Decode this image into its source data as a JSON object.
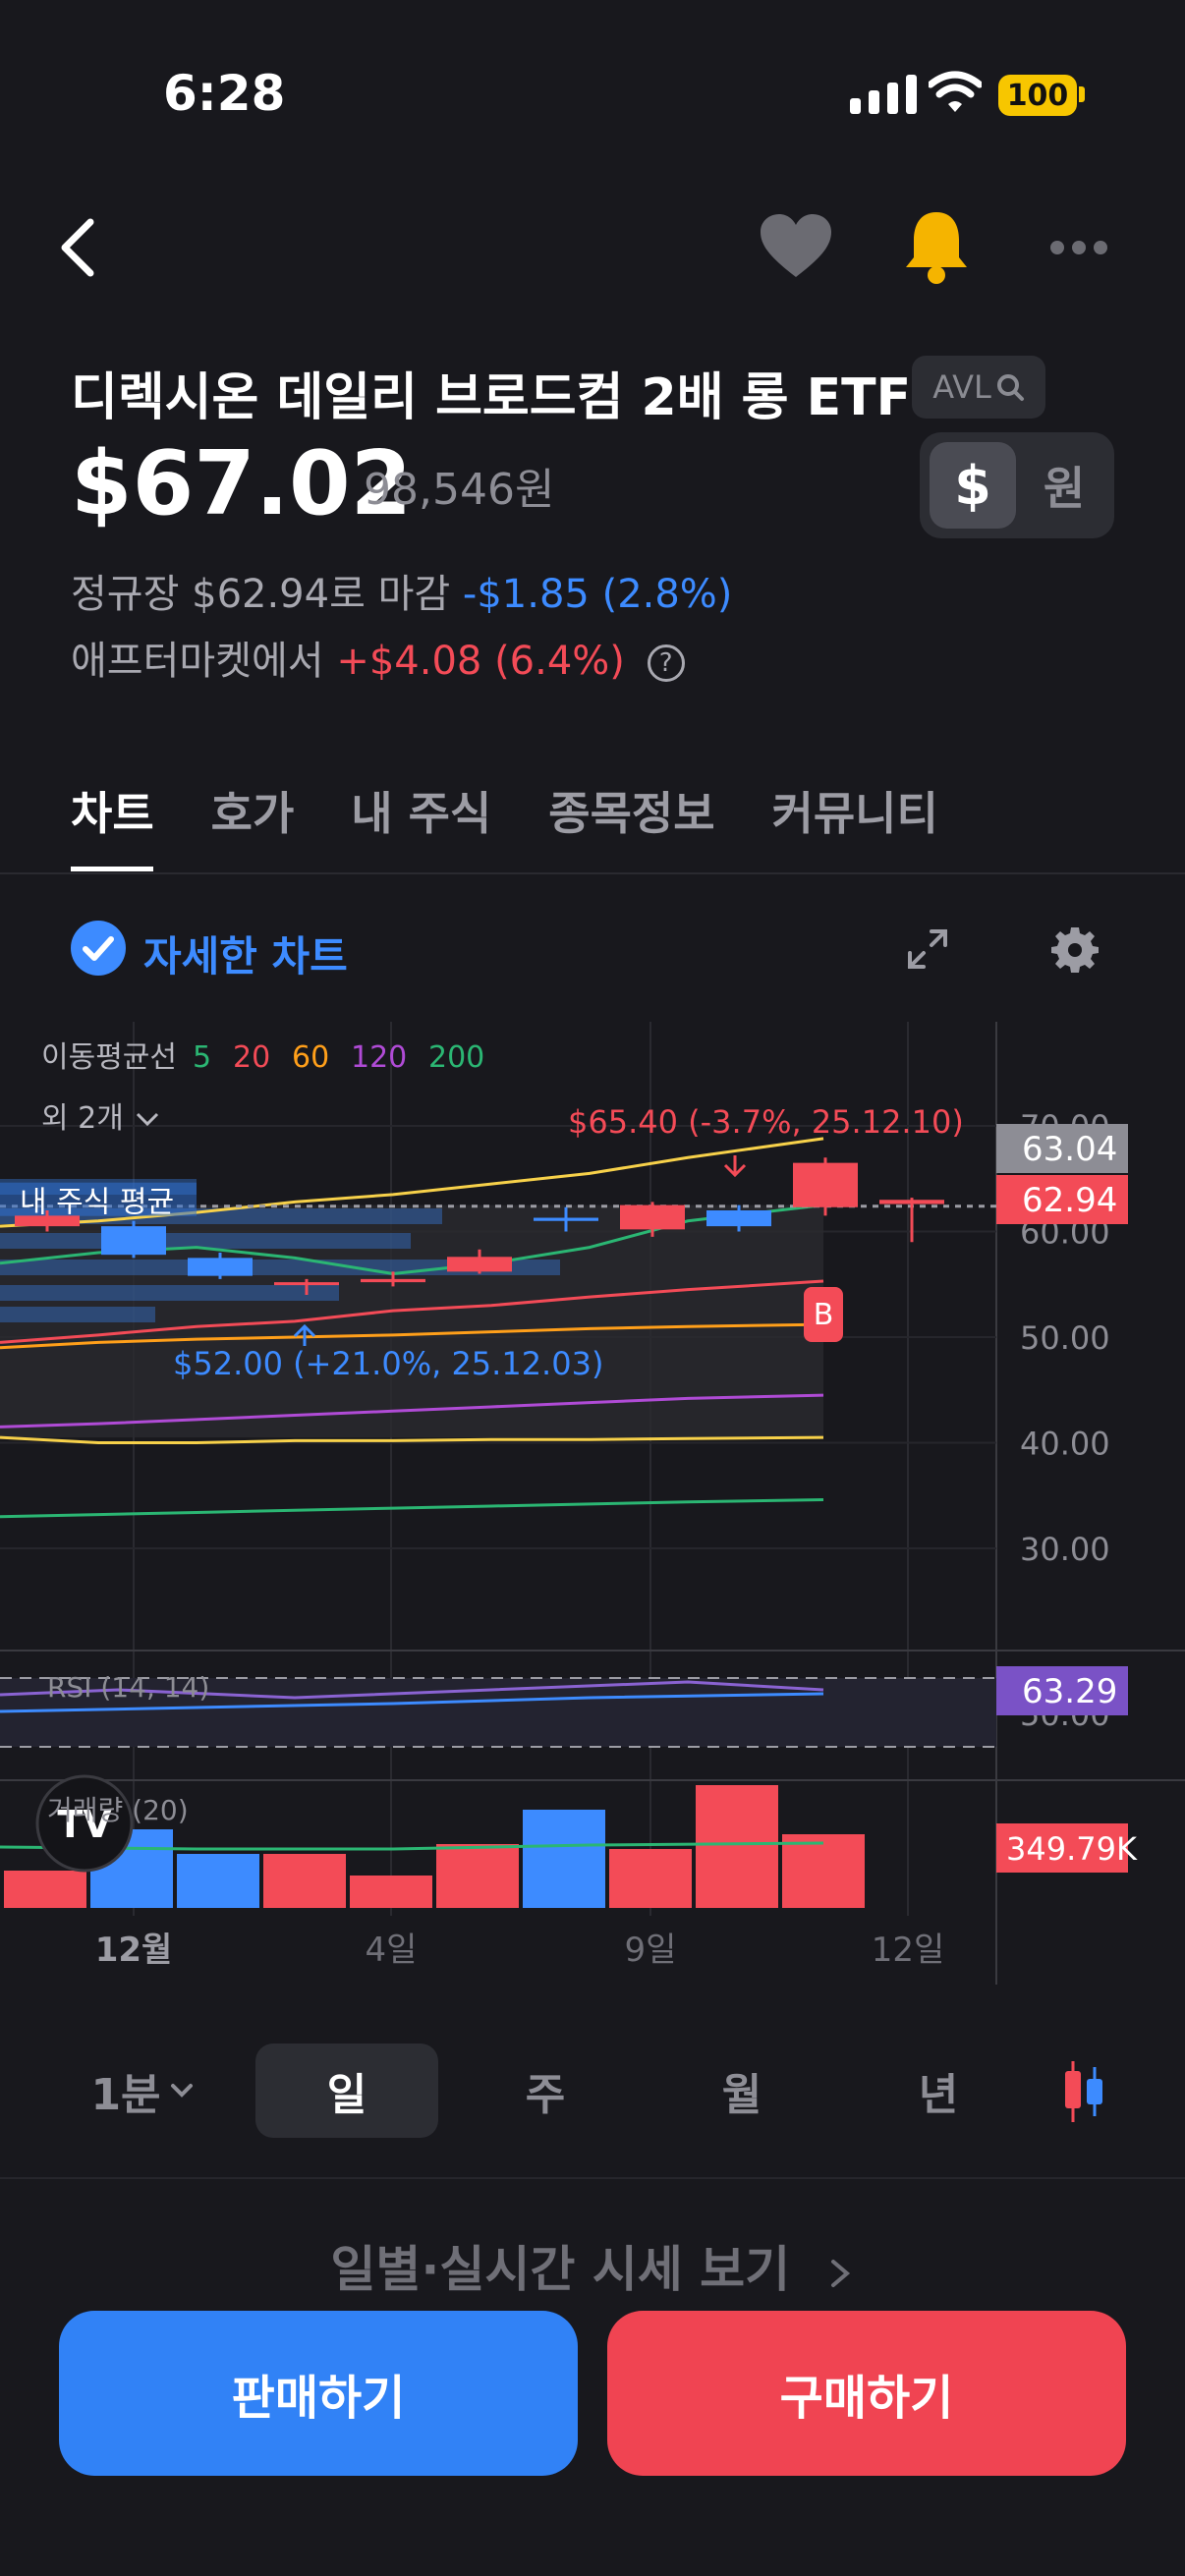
{
  "status_bar": {
    "time": "6:28",
    "battery": "100"
  },
  "header": {
    "title": "디렉시온 데일리 브로드컴 2배 롱 ETF",
    "ticker": "AVL",
    "price": "$67.02",
    "price_krw": "98,546원",
    "currency_dollar": "$",
    "currency_won": "원",
    "regular_close_label": "정규장 $62.94로 마감",
    "regular_change": "-$1.85 (2.8%)",
    "after_label": "애프터마켓에서",
    "after_change": "+$4.08 (6.4%)",
    "help_glyph": "?"
  },
  "tabs": [
    "차트",
    "호가",
    "내 주식",
    "종목정보",
    "커뮤니티"
  ],
  "detail_chart_label": "자세한 차트",
  "chart_data": {
    "type": "candlestick",
    "ma_title": "이동평균선",
    "ma_periods": [
      {
        "label": "5",
        "color": "#2bb673"
      },
      {
        "label": "20",
        "color": "#f34b57"
      },
      {
        "label": "60",
        "color": "#ff9f1a"
      },
      {
        "label": "120",
        "color": "#b04bd6"
      },
      {
        "label": "200",
        "color": "#2bb673"
      }
    ],
    "more_label": "외 2개",
    "my_avg_label": "내 주식 평균",
    "ylim": [
      20,
      75
    ],
    "y_ticks": [
      "70.00",
      "60.00",
      "50.00",
      "40.00",
      "30.00"
    ],
    "x_ticks": [
      "12월",
      "4일",
      "9일",
      "12일"
    ],
    "candles": [
      {
        "open": 61.5,
        "close": 60.5,
        "high": 62.0,
        "low": 60.0,
        "color": "red"
      },
      {
        "open": 60.5,
        "close": 57.8,
        "high": 61.0,
        "low": 57.5,
        "color": "blue"
      },
      {
        "open": 57.5,
        "close": 55.8,
        "high": 58.0,
        "low": 55.5,
        "color": "blue"
      },
      {
        "open": 55.0,
        "close": 55.2,
        "high": 55.5,
        "low": 54.0,
        "color": "red"
      },
      {
        "open": 55.2,
        "close": 55.5,
        "high": 56.2,
        "low": 54.8,
        "color": "red"
      },
      {
        "open": 56.2,
        "close": 57.6,
        "high": 58.3,
        "low": 56.0,
        "color": "red"
      },
      {
        "open": 61.0,
        "close": 61.3,
        "high": 62.3,
        "low": 60.0,
        "color": "blue"
      },
      {
        "open": 60.2,
        "close": 62.5,
        "high": 62.8,
        "low": 59.5,
        "color": "red"
      },
      {
        "open": 62.0,
        "close": 60.5,
        "high": 62.5,
        "low": 60.0,
        "color": "blue"
      },
      {
        "open": 62.3,
        "close": 66.5,
        "high": 67.0,
        "low": 61.5,
        "color": "red"
      },
      {
        "open": 63.0,
        "close": 62.6,
        "high": 63.2,
        "low": 59.0,
        "color": "red"
      }
    ],
    "high_annotation": "$65.40 (-3.7%, 25.12.10)",
    "low_annotation": "$52.00 (+21.0%, 25.12.03)",
    "current_price_tags": [
      "63.04",
      "62.94"
    ],
    "buy_marker": "B",
    "rsi": {
      "label": "RSI (14, 14)",
      "value": "63.29",
      "tick": "50.00"
    },
    "volume": {
      "label": "거래량 (20)",
      "value": "349.79K",
      "bars": [
        38,
        80,
        55,
        55,
        33,
        65,
        100,
        60,
        125,
        75
      ],
      "colors": [
        "red",
        "blue",
        "blue",
        "red",
        "red",
        "red",
        "blue",
        "red",
        "red",
        "red"
      ]
    }
  },
  "periods": {
    "minute": "1분",
    "day": "일",
    "week": "주",
    "month": "월",
    "year": "년"
  },
  "daily_link": "일별·실시간 시세 보기",
  "buttons": {
    "sell": "판매하기",
    "buy": "구매하기"
  },
  "colors": {
    "accent_blue": "#3182f6",
    "accent_red": "#f04452",
    "background": "#18181d"
  }
}
